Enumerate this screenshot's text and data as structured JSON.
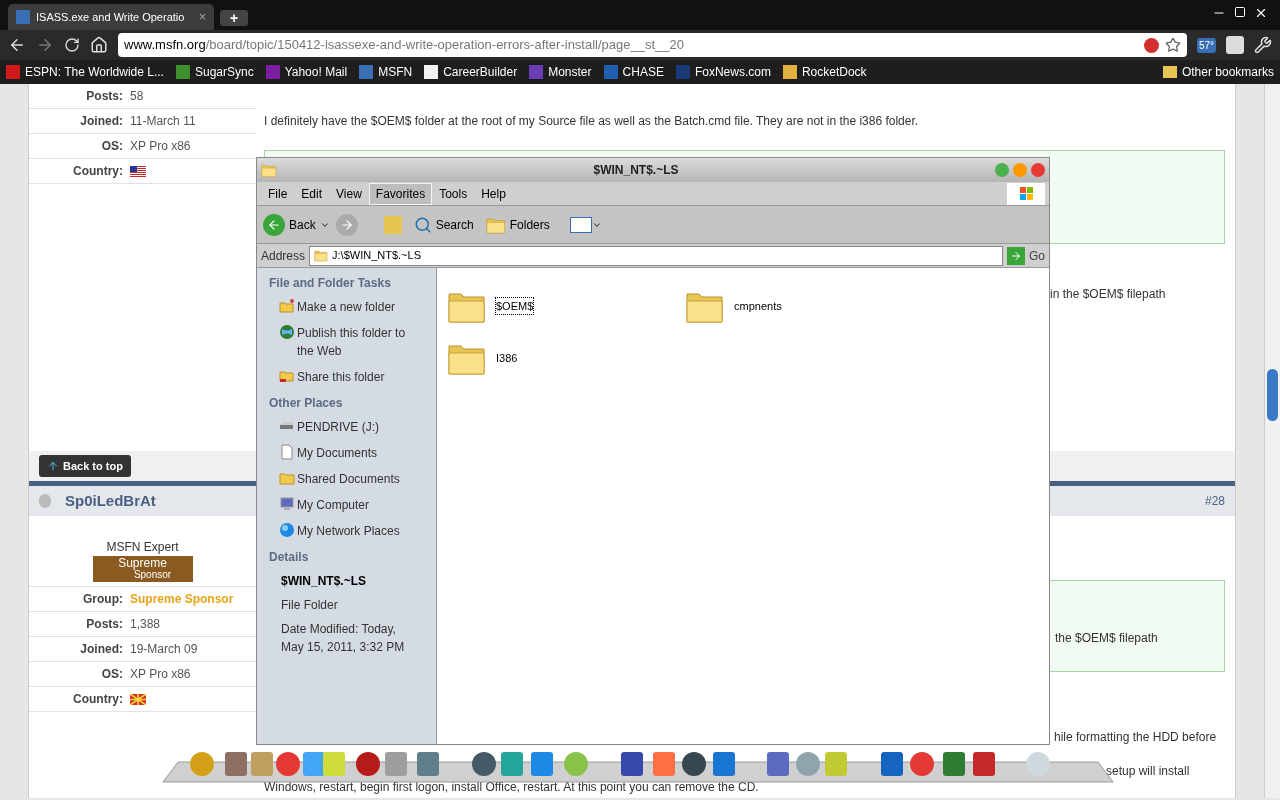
{
  "browser": {
    "tab_title": "ISASS.exe and Write Operatio",
    "tab_close": "×",
    "new_tab": "+",
    "url_host": "www.msfn.org",
    "url_path": "/board/topic/150412-isassexe-and-write-operation-errors-after-install/page__st__20",
    "weather": "57°",
    "bookmarks": [
      {
        "label": "ESPN: The Worldwide L...",
        "color": "#d11a1a"
      },
      {
        "label": "SugarSync",
        "color": "#3f8f2f"
      },
      {
        "label": "Yahoo! Mail",
        "color": "#7b1fa2"
      },
      {
        "label": "MSFN",
        "color": "#3a6fb5"
      },
      {
        "label": "CareerBuilder",
        "color": "#f2f2f2"
      },
      {
        "label": "Monster",
        "color": "#6a3fb5"
      },
      {
        "label": "CHASE",
        "color": "#1f5fb0"
      },
      {
        "label": "FoxNews.com",
        "color": "#1b3a78"
      },
      {
        "label": "RocketDock",
        "color": "#e0b040"
      }
    ],
    "other_bookmarks": "Other bookmarks"
  },
  "page": {
    "post1": {
      "fields": [
        {
          "label": "Posts:",
          "value": "58"
        },
        {
          "label": "Joined:",
          "value": "11-March 11"
        },
        {
          "label": "OS:",
          "value": "XP Pro x86"
        },
        {
          "label": "Country:",
          "kind": "flag_us"
        }
      ],
      "text": "I definitely have the $OEM$ folder at the root of my Source file as well as the Batch.cmd file. They are not in the i386 folder.",
      "fragment": "in the $OEM$ filepath"
    },
    "back_to_top": "Back to top",
    "post2": {
      "username": "Sp0iLedBrAt",
      "number": "#28",
      "rank": "MSFN Expert",
      "badge": [
        "Supreme",
        "Sponsor"
      ],
      "fields": [
        {
          "label": "Group:",
          "value": "Supreme Sponsor",
          "kind": "group"
        },
        {
          "label": "Posts:",
          "value": "1,388"
        },
        {
          "label": "Joined:",
          "value": "19-March 09"
        },
        {
          "label": "OS:",
          "value": "XP Pro x86"
        },
        {
          "label": "Country:",
          "kind": "flag_mk"
        }
      ],
      "fragment": "the $OEM$ filepath",
      "line1": "hile formatting the HDD before",
      "line2": "setup will install",
      "line3": "Windows, restart, begin first logon, install Office, restart. At this point you can remove the CD."
    }
  },
  "explorer": {
    "title": "$WIN_NT$.~LS",
    "menu": [
      {
        "label": "File",
        "selected": false
      },
      {
        "label": "Edit",
        "selected": false
      },
      {
        "label": "View",
        "selected": false
      },
      {
        "label": "Favorites",
        "selected": true
      },
      {
        "label": "Tools",
        "selected": false
      },
      {
        "label": "Help",
        "selected": false
      }
    ],
    "back": "Back",
    "search": "Search",
    "folders": "Folders",
    "address_label": "Address",
    "address": "J:\\$WIN_NT$.~LS",
    "go": "Go",
    "sections": [
      {
        "title": "File and Folder Tasks",
        "items": [
          {
            "label": "Make a new folder",
            "kind": "newfolder"
          },
          {
            "label": "Publish this folder to the Web",
            "kind": "globe"
          },
          {
            "label": "Share this folder",
            "kind": "share"
          }
        ]
      },
      {
        "title": "Other Places",
        "items": [
          {
            "label": "PENDRIVE (J:)",
            "kind": "drive"
          },
          {
            "label": "My Documents",
            "kind": "doc"
          },
          {
            "label": "Shared Documents",
            "kind": "folder"
          },
          {
            "label": "My Computer",
            "kind": "computer"
          },
          {
            "label": "My Network Places",
            "kind": "network"
          }
        ]
      }
    ],
    "details": {
      "title": "Details",
      "name": "$WIN_NT$.~LS",
      "type": "File Folder",
      "modified": "Date Modified: Today, May 15, 2011, 3:32 PM"
    },
    "files": [
      {
        "name": "$OEM$",
        "selected": true
      },
      {
        "name": "cmpnents",
        "selected": false
      },
      {
        "name": "I386",
        "selected": false
      }
    ]
  }
}
